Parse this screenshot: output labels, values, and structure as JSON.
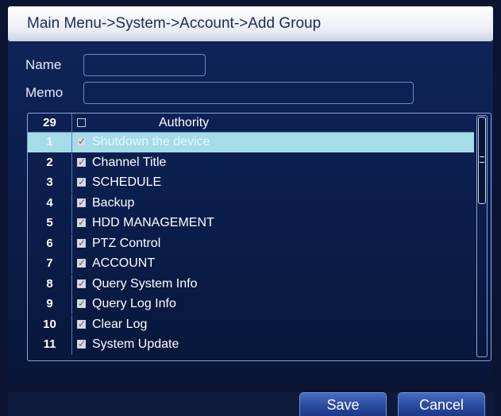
{
  "title": "Main Menu->System->Account->Add Group",
  "form": {
    "name_label": "Name",
    "name_value": "",
    "memo_label": "Memo",
    "memo_value": ""
  },
  "authority_list": {
    "header_count": "29",
    "header_checked": false,
    "header_label": "Authority",
    "rows": [
      {
        "num": "1",
        "label": "Shutdown the device",
        "checked": true,
        "selected": true
      },
      {
        "num": "2",
        "label": "Channel Title",
        "checked": true,
        "selected": false
      },
      {
        "num": "3",
        "label": "SCHEDULE",
        "checked": true,
        "selected": false
      },
      {
        "num": "4",
        "label": "Backup",
        "checked": true,
        "selected": false
      },
      {
        "num": "5",
        "label": "HDD MANAGEMENT",
        "checked": true,
        "selected": false
      },
      {
        "num": "6",
        "label": "PTZ Control",
        "checked": true,
        "selected": false
      },
      {
        "num": "7",
        "label": "ACCOUNT",
        "checked": true,
        "selected": false
      },
      {
        "num": "8",
        "label": "Query System Info",
        "checked": true,
        "selected": false
      },
      {
        "num": "9",
        "label": "Query Log Info",
        "checked": true,
        "selected": false
      },
      {
        "num": "10",
        "label": "Clear Log",
        "checked": true,
        "selected": false
      },
      {
        "num": "11",
        "label": "System Update",
        "checked": true,
        "selected": false
      }
    ]
  },
  "buttons": {
    "save_label": "Save",
    "cancel_label": "Cancel"
  },
  "colors": {
    "background": "#0b1430",
    "selected_row": "#a4dce8",
    "button": "#2a4b9e"
  }
}
